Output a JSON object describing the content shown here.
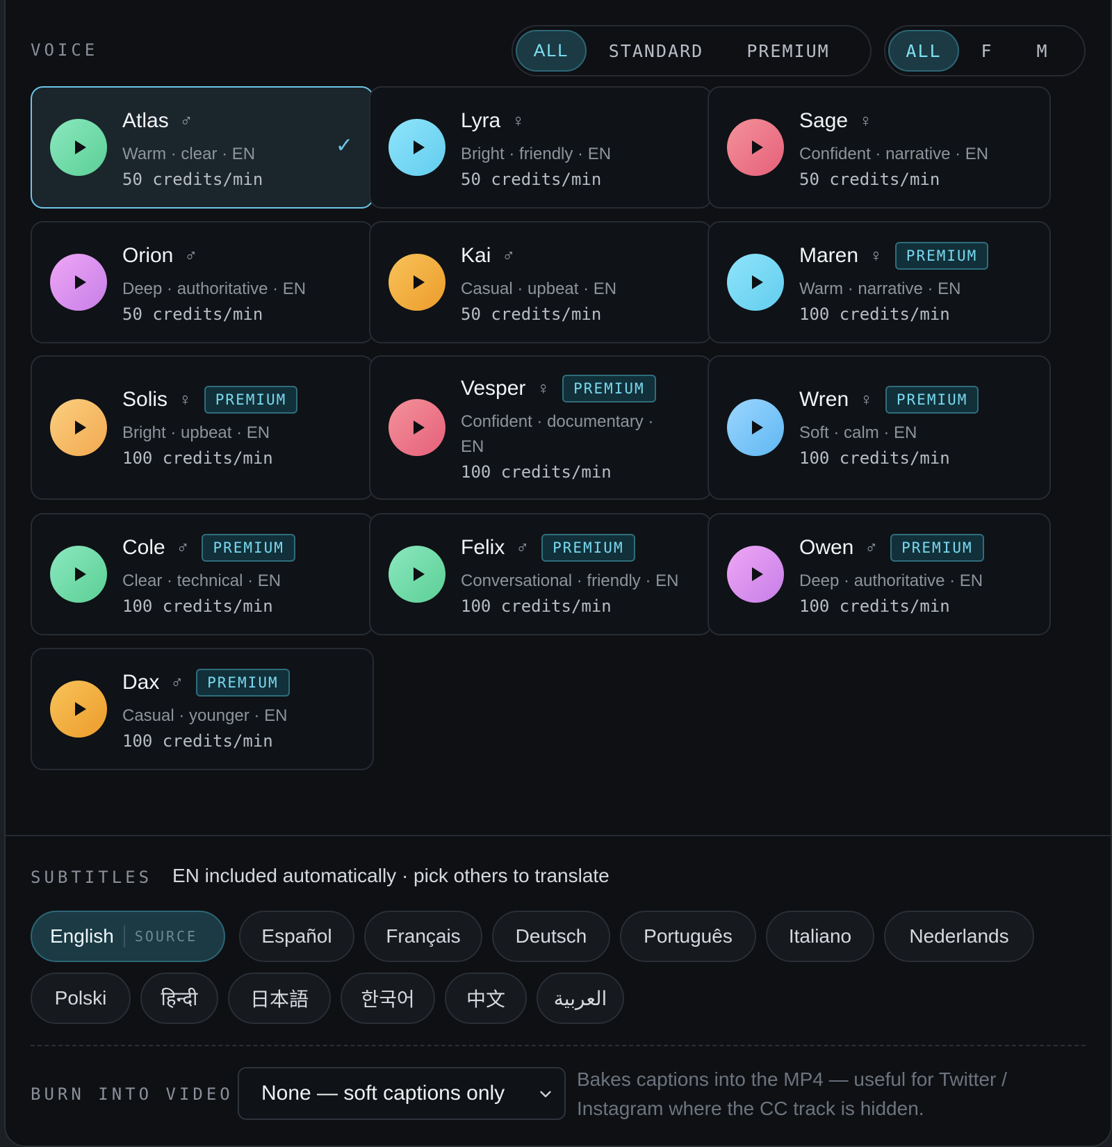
{
  "voice": {
    "label": "VOICE",
    "tier_filter": [
      {
        "label": "ALL",
        "active": true
      },
      {
        "label": "STANDARD",
        "active": false
      },
      {
        "label": "PREMIUM",
        "active": false
      }
    ],
    "gender_filter": [
      {
        "label": "ALL",
        "active": true
      },
      {
        "label": "F",
        "active": false
      },
      {
        "label": "M",
        "active": false
      }
    ],
    "premium_badge": "PREMIUM",
    "selected_check": "✓",
    "voices": [
      {
        "name": "Atlas",
        "gender": "♂",
        "desc": "Warm · clear · EN",
        "credits": "50 credits/min",
        "premium": false,
        "selected": true,
        "color": "green"
      },
      {
        "name": "Lyra",
        "gender": "♀",
        "desc": "Bright · friendly · EN",
        "credits": "50 credits/min",
        "premium": false,
        "selected": false,
        "color": "cyan"
      },
      {
        "name": "Sage",
        "gender": "♀",
        "desc": "Confident · narrative · EN",
        "credits": "50 credits/min",
        "premium": false,
        "selected": false,
        "color": "red"
      },
      {
        "name": "Orion",
        "gender": "♂",
        "desc": "Deep · authoritative · EN",
        "credits": "50 credits/min",
        "premium": false,
        "selected": false,
        "color": "violet"
      },
      {
        "name": "Kai",
        "gender": "♂",
        "desc": "Casual · upbeat · EN",
        "credits": "50 credits/min",
        "premium": false,
        "selected": false,
        "color": "amber"
      },
      {
        "name": "Maren",
        "gender": "♀",
        "desc": "Warm · narrative · EN",
        "credits": "100 credits/min",
        "premium": true,
        "selected": false,
        "color": "cyan"
      },
      {
        "name": "Solis",
        "gender": "♀",
        "desc": "Bright · upbeat · EN",
        "credits": "100 credits/min",
        "premium": true,
        "selected": false,
        "color": "peach"
      },
      {
        "name": "Vesper",
        "gender": "♀",
        "desc": "Confident · documentary · EN",
        "credits": "100 credits/min",
        "premium": true,
        "selected": false,
        "color": "red"
      },
      {
        "name": "Wren",
        "gender": "♀",
        "desc": "Soft · calm · EN",
        "credits": "100 credits/min",
        "premium": true,
        "selected": false,
        "color": "sky"
      },
      {
        "name": "Cole",
        "gender": "♂",
        "desc": "Clear · technical · EN",
        "credits": "100 credits/min",
        "premium": true,
        "selected": false,
        "color": "green"
      },
      {
        "name": "Felix",
        "gender": "♂",
        "desc": "Conversational · friendly · EN",
        "credits": "100 credits/min",
        "premium": true,
        "selected": false,
        "color": "green"
      },
      {
        "name": "Owen",
        "gender": "♂",
        "desc": "Deep · authoritative · EN",
        "credits": "100 credits/min",
        "premium": true,
        "selected": false,
        "color": "violet"
      },
      {
        "name": "Dax",
        "gender": "♂",
        "desc": "Casual · younger · EN",
        "credits": "100 credits/min",
        "premium": true,
        "selected": false,
        "color": "amber"
      }
    ]
  },
  "subtitles": {
    "label": "SUBTITLES",
    "hint": "EN included automatically · pick others to translate",
    "source_tag": "SOURCE",
    "languages": [
      {
        "label": "English",
        "source": true
      },
      {
        "label": "Español",
        "source": false
      },
      {
        "label": "Français",
        "source": false
      },
      {
        "label": "Deutsch",
        "source": false
      },
      {
        "label": "Português",
        "source": false
      },
      {
        "label": "Italiano",
        "source": false
      },
      {
        "label": "Nederlands",
        "source": false
      },
      {
        "label": "Polski",
        "source": false
      },
      {
        "label": "हिन्दी",
        "source": false
      },
      {
        "label": "日本語",
        "source": false
      },
      {
        "label": "한국어",
        "source": false
      },
      {
        "label": "中文",
        "source": false
      },
      {
        "label": "العربية",
        "source": false
      }
    ]
  },
  "burn": {
    "label": "BURN INTO VIDEO",
    "selected": "None — soft captions only",
    "help": "Bakes captions into the MP4 — useful for Twitter / Instagram where the CC track is hidden."
  }
}
